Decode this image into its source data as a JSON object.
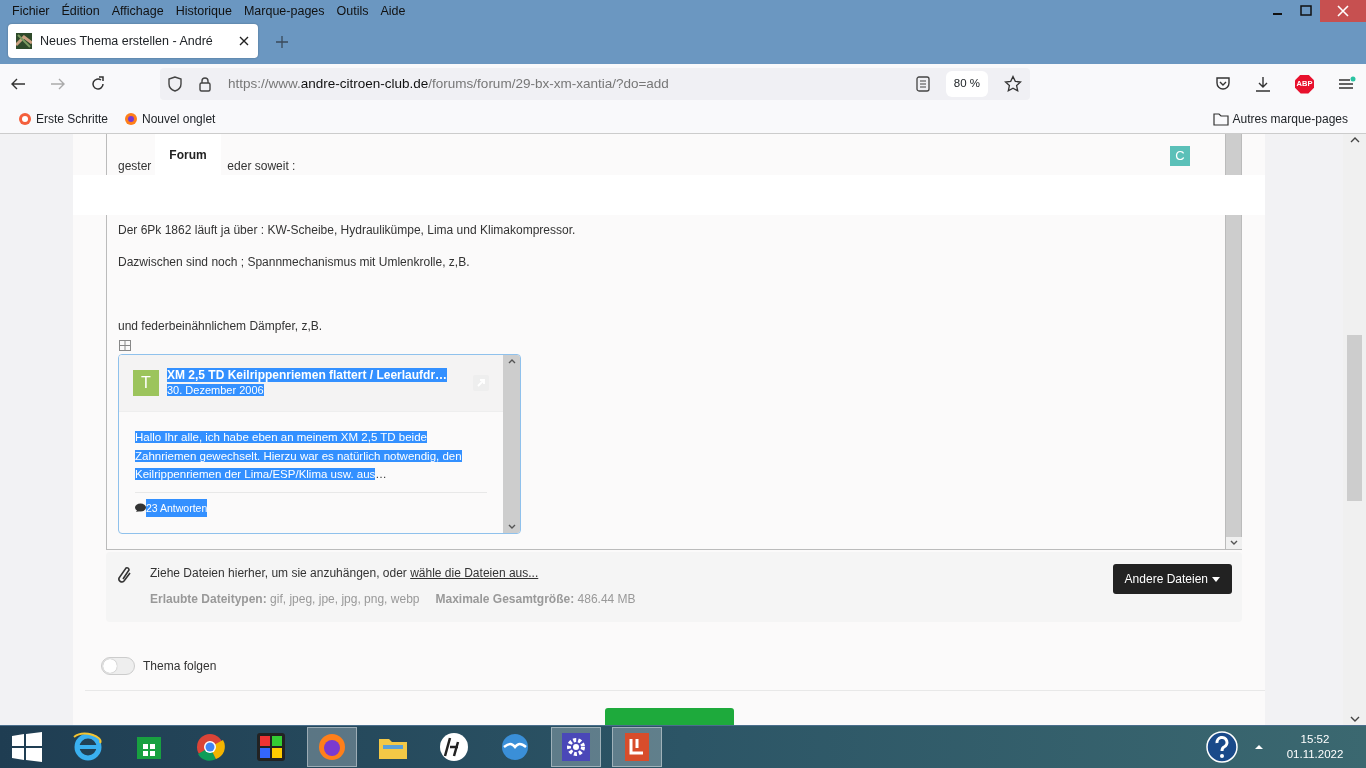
{
  "browser": {
    "menu": [
      {
        "label": "Fichier"
      },
      {
        "label": "Édition"
      },
      {
        "label": "Affichage"
      },
      {
        "label": "Historique"
      },
      {
        "label": "Marque-pages"
      },
      {
        "label": "Outils"
      },
      {
        "label": "Aide"
      }
    ],
    "tabs": [
      {
        "title": "Neues Thema erstellen - André",
        "selected": true
      }
    ],
    "url": {
      "scheme": "https://www.",
      "domain": "andre-citroen-club.de",
      "path": "/forums/forum/29-bx-xm-xantia/?do=add"
    },
    "zoom": "80 %",
    "adblock_label": "ABP",
    "bookmarks": [
      {
        "label": "Erste Schritte"
      },
      {
        "label": "Nouvel onglet"
      }
    ],
    "other_bookmarks": "Autres marque-pages"
  },
  "site_nav": {
    "items": [
      {
        "label": "Forum",
        "selected": true
      }
    ],
    "avatar": "C"
  },
  "editor": {
    "partial_line": [
      "gester",
      "eder soweit :"
    ],
    "paragraph_groups": [
      [
        "Der 6Pk 1862 läuft ja über : KW-Scheibe, Hydraulikümpe, Lima und Klimakompressor.",
        "Dazwischen sind noch ; Spannmechanismus mit Umlenkrolle, z,B."
      ],
      [
        "und federbeinähnlichem Dämpfer, z,B."
      ]
    ],
    "embed": {
      "avatar": "T",
      "title": "XM 2,5 TD Keilrippenriemen flattert / Leerlaufdr…",
      "date": "30. Dezember 2006",
      "excerpt": "Hallo Ihr alle, ich habe eben an meinem XM 2,5 TD beide Zahnriemen gewechselt. Hierzu war es natürlich notwendig, den Keilrippenriemen der Lima/ESP/Klima usw. aus",
      "ellipsis": "…",
      "replies": "23 Antworten",
      "selected": true
    }
  },
  "attachments": {
    "prompt": "Ziehe Dateien hierher, um sie anzuhängen, oder ",
    "link": "wähle die Dateien aus...",
    "allowed_label": "Erlaubte Dateitypen:",
    "allowed": "gif, jpeg, jpe, jpg, png, webp",
    "max_label": "Maximale Gesamtgröße:",
    "max": "486.44 MB",
    "button": "Andere Dateien"
  },
  "follow": {
    "label": "Thema folgen",
    "on": false
  },
  "taskbar": {
    "time": "15:52",
    "date": "01.11.2022"
  }
}
